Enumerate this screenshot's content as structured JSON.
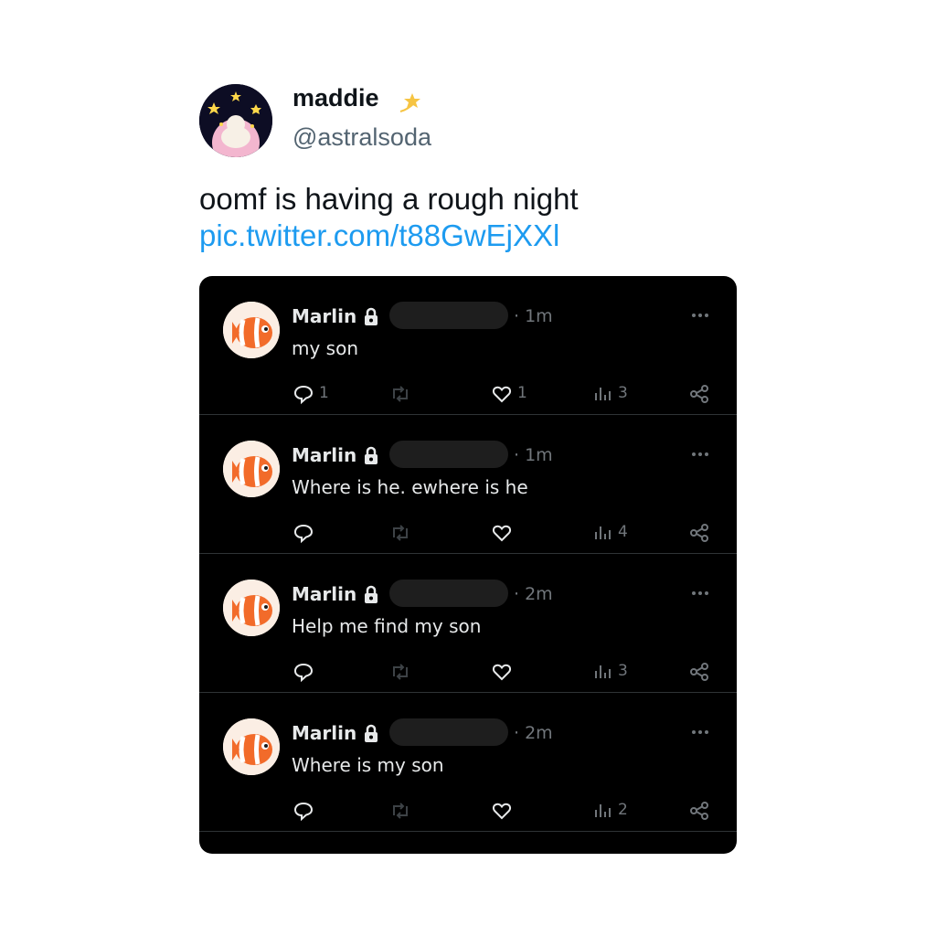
{
  "tweet": {
    "author_name": "maddie",
    "author_handle": "@astralsoda",
    "text": "oomf is having a rough night",
    "link": "pic.twitter.com/t88GwEjXXl"
  },
  "embedded_posts": [
    {
      "name": "Marlin",
      "time": "· 1m",
      "text": "my son",
      "replies": "1",
      "likes": "1",
      "views": "3"
    },
    {
      "name": "Marlin",
      "time": "· 1m",
      "text": "Where is he. ewhere is he",
      "replies": "",
      "likes": "",
      "views": "4"
    },
    {
      "name": "Marlin",
      "time": "· 2m",
      "text": "Help me find my son",
      "replies": "",
      "likes": "",
      "views": "3"
    },
    {
      "name": "Marlin",
      "time": "· 2m",
      "text": "Where is my son",
      "replies": "",
      "likes": "",
      "views": "2"
    }
  ],
  "icons": {
    "verified_badge": "shooting-star-icon",
    "lock": "lock-icon",
    "more": "more-icon",
    "reply": "reply-icon",
    "retweet": "retweet-icon",
    "like": "heart-icon",
    "views": "views-icon",
    "share": "share-icon"
  },
  "colors": {
    "link": "#1d9bf0",
    "embed_background": "#000000",
    "embed_text": "#e7e9ea",
    "embed_muted": "#71767b"
  }
}
